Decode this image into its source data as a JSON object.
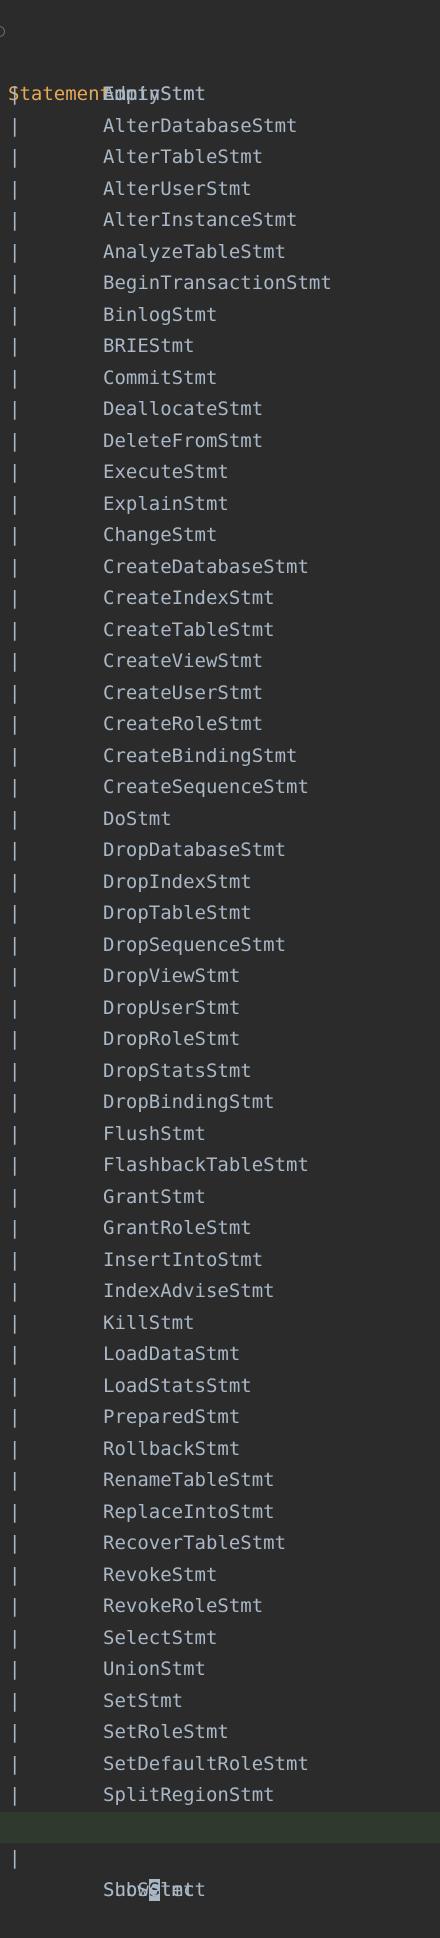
{
  "editor": {
    "rule_name": "Statement",
    "rule_colon": ":",
    "pipe": "|",
    "first_alternative": "EmptyStmt",
    "alternatives": [
      "AdminStmt",
      "AlterDatabaseStmt",
      "AlterTableStmt",
      "AlterUserStmt",
      "AlterInstanceStmt",
      "AnalyzeTableStmt",
      "BeginTransactionStmt",
      "BinlogStmt",
      "BRIEStmt",
      "CommitStmt",
      "DeallocateStmt",
      "DeleteFromStmt",
      "ExecuteStmt",
      "ExplainStmt",
      "ChangeStmt",
      "CreateDatabaseStmt",
      "CreateIndexStmt",
      "CreateTableStmt",
      "CreateViewStmt",
      "CreateUserStmt",
      "CreateRoleStmt",
      "CreateBindingStmt",
      "CreateSequenceStmt",
      "DoStmt",
      "DropDatabaseStmt",
      "DropIndexStmt",
      "DropTableStmt",
      "DropSequenceStmt",
      "DropViewStmt",
      "DropUserStmt",
      "DropRoleStmt",
      "DropStatsStmt",
      "DropBindingStmt",
      "FlushStmt",
      "FlashbackTableStmt",
      "GrantStmt",
      "GrantRoleStmt",
      "InsertIntoStmt",
      "IndexAdviseStmt",
      "KillStmt",
      "LoadDataStmt",
      "LoadStatsStmt",
      "PreparedStmt",
      "RollbackStmt",
      "RenameTableStmt",
      "ReplaceIntoStmt",
      "RecoverTableStmt",
      "RevokeStmt",
      "RevokeRoleStmt",
      "SelectStmt",
      "UnionStmt",
      "SetStmt",
      "SetRoleStmt",
      "SetDefaultRoleStmt",
      "SplitRegionStmt"
    ],
    "current_line": {
      "before_caret": "Show",
      "caret_char": "S",
      "after_caret": "tmt"
    },
    "trailing_partial": "SubSelect",
    "colors": {
      "background": "#2b2b2b",
      "rule_name": "#e5a857",
      "text": "#a9b7c6",
      "current_line_highlight": "#2f3a2e"
    }
  }
}
